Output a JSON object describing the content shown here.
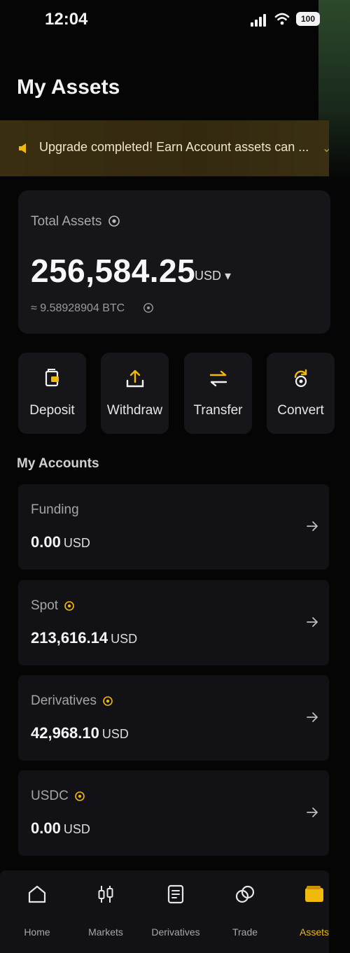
{
  "status_bar": {
    "time": "12:04",
    "battery": "100"
  },
  "page": {
    "title": "My Assets"
  },
  "banner": {
    "text": "Upgrade completed! Earn Account assets can ...",
    "icon": "speaker-icon"
  },
  "total": {
    "label": "Total Assets",
    "amount": "256,584.25",
    "currency": "USD ▾",
    "btc": "≈ 9.58928904 BTC"
  },
  "actions": [
    {
      "label": "Deposit",
      "icon": "deposit-icon"
    },
    {
      "label": "Withdraw",
      "icon": "withdraw-icon"
    },
    {
      "label": "Transfer",
      "icon": "transfer-icon"
    },
    {
      "label": "Convert",
      "icon": "convert-icon"
    }
  ],
  "accounts_section": {
    "title": "My Accounts"
  },
  "accounts": [
    {
      "name": "Funding",
      "value": "0.00",
      "unit": "USD"
    },
    {
      "name": "Spot",
      "value": "213,616.14",
      "unit": "USD"
    },
    {
      "name": "Derivatives",
      "value": "42,968.10",
      "unit": "USD"
    },
    {
      "name": "USDC",
      "value": "0.00",
      "unit": "USD"
    }
  ],
  "nav": [
    {
      "label": "Home",
      "icon": "home-icon"
    },
    {
      "label": "Markets",
      "icon": "markets-icon"
    },
    {
      "label": "Derivatives",
      "icon": "derivatives-icon"
    },
    {
      "label": "Trade",
      "icon": "trade-icon"
    },
    {
      "label": "Assets",
      "icon": "wallet-icon"
    }
  ],
  "colors": {
    "accent": "#f0b90b",
    "card": "#16161a",
    "background": "#050505"
  }
}
